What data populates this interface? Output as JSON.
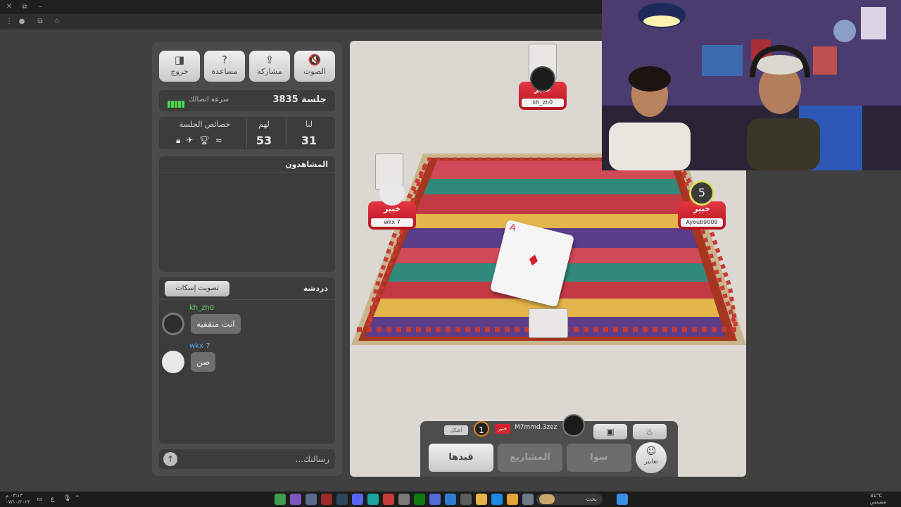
{
  "panel": {
    "buttons": {
      "sound": "الصوت",
      "share": "مشاركة",
      "help": "مساعدة",
      "exit": "خروج"
    },
    "session": "جلسة 3835",
    "connection_label": "سرعة اتصالك",
    "score": {
      "us_label": "لنا",
      "them_label": "لهم",
      "props_label": "خصائص الجلسة",
      "us": "31",
      "them": "53"
    },
    "viewers_title": "المشاهدون",
    "chat": {
      "title": "دردشة",
      "mute_vote": "تصويت إسكات",
      "messages": [
        {
          "name": "kh_zh0",
          "text": "انت متقفيه"
        },
        {
          "name": "wkx 7",
          "text": "صن"
        }
      ],
      "placeholder": "رسالتك..."
    }
  },
  "game": {
    "players": [
      {
        "tag": "خبير",
        "name": "kh_zh0"
      },
      {
        "tag": "خبير",
        "name": "wkx 7"
      },
      {
        "tag": "خبير",
        "name": "Ayoub9009"
      }
    ],
    "timer": "5",
    "played_card": {
      "rank": "A",
      "suit": "♦"
    },
    "me": {
      "name": "M7mmd.3zez",
      "tag": "خبير",
      "badge": "1",
      "status": "أشكل"
    },
    "actions": {
      "qaydha": "قيدها",
      "projects": "المشاريع",
      "sawa": "سوا",
      "emotes": "تعابير"
    }
  },
  "taskbar": {
    "search": "بحث",
    "weather": "31°C",
    "weather_sub": "مشمس",
    "time": "٠٣:١٣ م",
    "date": "٠٧/١٠/٢٠٢٣",
    "lang": "ع"
  },
  "colors": {
    "accent_red": "#d3212e",
    "connection_green": "#4cd74c",
    "panel_bg": "#4b4b4b"
  }
}
